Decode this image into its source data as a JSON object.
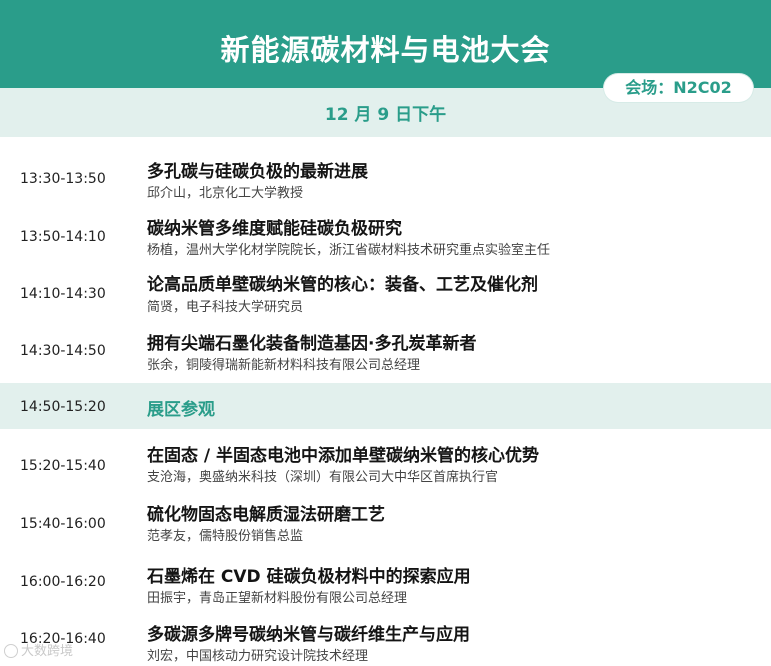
{
  "header": {
    "title": "新能源碳材料与电池大会"
  },
  "venue": {
    "label": "会场：N2C02"
  },
  "date": {
    "label": "12 月 9 日下午"
  },
  "sessions": [
    {
      "time": "13:30-13:50",
      "title": "多孔碳与硅碳负极的最新进展",
      "speaker": "邱介山，北京化工大学教授"
    },
    {
      "time": "13:50-14:10",
      "title": "碳纳米管多维度赋能硅碳负极研究",
      "speaker": "杨植，温州大学化材学院院长，浙江省碳材料技术研究重点实验室主任"
    },
    {
      "time": "14:10-14:30",
      "title": "论高品质单壁碳纳米管的核心：装备、工艺及催化剂",
      "speaker": "简贤，电子科技大学研究员"
    },
    {
      "time": "14:30-14:50",
      "title": "拥有尖端石墨化装备制造基因·多孔炭革新者",
      "speaker": "张余，铜陵得瑞新能新材料科技有限公司总经理"
    },
    {
      "time": "15:20-15:40",
      "title": "在固态 / 半固态电池中添加单壁碳纳米管的核心优势",
      "speaker": "支沧海，奥盛纳米科技（深圳）有限公司大中华区首席执行官"
    },
    {
      "time": "15:40-16:00",
      "title": "硫化物固态电解质湿法研磨工艺",
      "speaker": "范孝友，儒特股份销售总监"
    },
    {
      "time": "16:00-16:20",
      "title": "石墨烯在 CVD 硅碳负极材料中的探索应用",
      "speaker": "田振宇，青岛正望新材料股份有限公司总经理"
    },
    {
      "time": "16:20-16:40",
      "title": "多碳源多牌号碳纳米管与碳纤维生产与应用",
      "speaker": "刘宏，中国核动力研究设计院技术经理"
    }
  ],
  "break": {
    "time": "14:50-15:20",
    "label": "展区参观"
  },
  "watermark": {
    "text": "大数跨境"
  },
  "colors": {
    "accent": "#2a9d8a",
    "band": "#e2f0ed"
  }
}
